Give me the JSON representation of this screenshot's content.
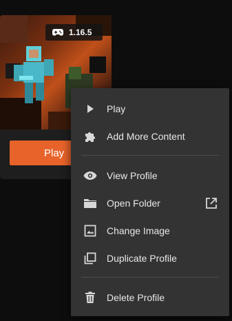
{
  "card": {
    "version": "1.16.5",
    "play_label": "Play"
  },
  "menu": {
    "items": [
      {
        "label": "Play",
        "icon": "play-icon"
      },
      {
        "label": "Add More Content",
        "icon": "puzzle-icon"
      },
      {
        "label": "View Profile",
        "icon": "eye-icon"
      },
      {
        "label": "Open Folder",
        "icon": "folder-icon",
        "trailing_icon": "external-link-icon"
      },
      {
        "label": "Change Image",
        "icon": "image-icon"
      },
      {
        "label": "Duplicate Profile",
        "icon": "duplicate-icon"
      },
      {
        "label": "Delete Profile",
        "icon": "trash-icon"
      }
    ]
  },
  "colors": {
    "accent": "#e8632a",
    "menu_bg": "#333333",
    "text": "#e8e8e8"
  }
}
